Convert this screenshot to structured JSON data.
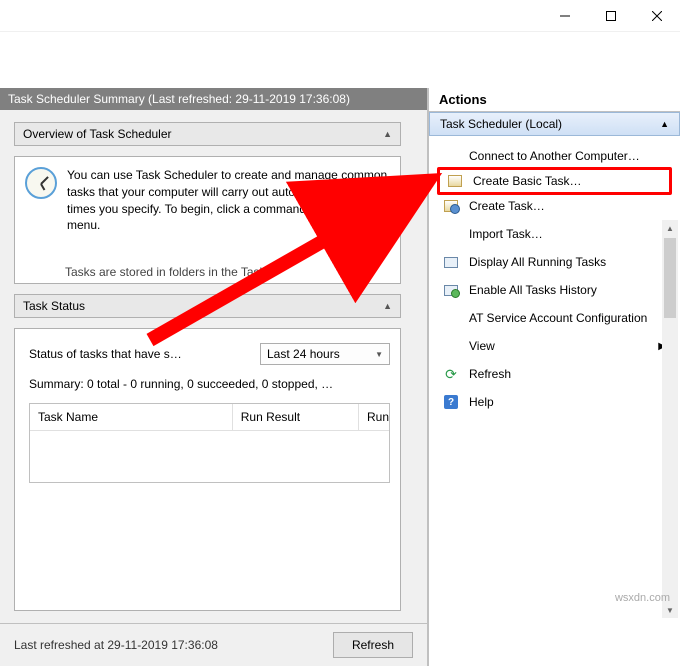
{
  "summary_header": "Task Scheduler Summary (Last refreshed: 29-11-2019 17:36:08)",
  "overview": {
    "title": "Overview of Task Scheduler",
    "body": "You can use Task Scheduler to create and manage common tasks that your computer will carry out automatically at the times you specify. To begin, click a command in the Action menu.",
    "truncated_line": "Tasks are stored in folders in the Task"
  },
  "task_status": {
    "title": "Task Status",
    "status_label": "Status of tasks that have s…",
    "dropdown_value": "Last 24 hours",
    "summary_line": "Summary: 0 total - 0 running, 0 succeeded, 0 stopped, …",
    "columns": {
      "c1": "Task Name",
      "c2": "Run Result",
      "c3": "Run"
    }
  },
  "footer": {
    "text": "Last refreshed at 29-11-2019 17:36:08",
    "refresh": "Refresh"
  },
  "actions": {
    "header": "Actions",
    "group": "Task Scheduler (Local)",
    "items": [
      {
        "label": "Connect to Another Computer…",
        "icon": ""
      },
      {
        "label": "Create Basic Task…",
        "icon": "basic"
      },
      {
        "label": "Create Task…",
        "icon": "task"
      },
      {
        "label": "Import Task…",
        "icon": ""
      },
      {
        "label": "Display All Running Tasks",
        "icon": "display"
      },
      {
        "label": "Enable All Tasks History",
        "icon": "enable"
      },
      {
        "label": "AT Service Account Configuration",
        "icon": ""
      },
      {
        "label": "View",
        "icon": "",
        "has_sub": true
      },
      {
        "label": "Refresh",
        "icon": "refresh"
      },
      {
        "label": "Help",
        "icon": "help"
      }
    ]
  },
  "watermark": "wsxdn.com"
}
